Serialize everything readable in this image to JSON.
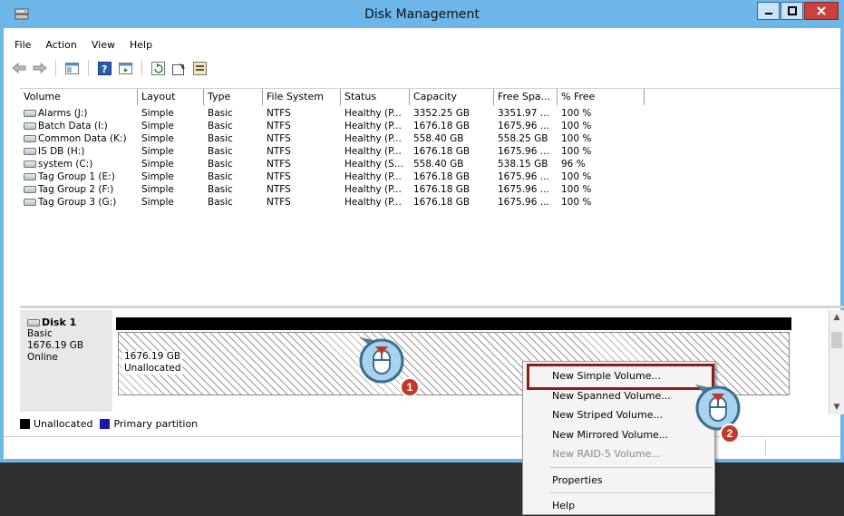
{
  "window": {
    "title": "Disk Management"
  },
  "menu": [
    "File",
    "Action",
    "View",
    "Help"
  ],
  "toolbar_icons": [
    "back-arrow-icon",
    "forward-arrow-icon",
    "console-icon",
    "help-icon",
    "view-icon",
    "refresh-icon",
    "properties-icon",
    "export-icon"
  ],
  "volume_list": {
    "columns": [
      "Volume",
      "Layout",
      "Type",
      "File System",
      "Status",
      "Capacity",
      "Free Spa...",
      "% Free"
    ],
    "rows": [
      [
        "Alarms (J:)",
        "Simple",
        "Basic",
        "NTFS",
        "Healthy (P...",
        "3352.25 GB",
        "3351.97 ...",
        "100 %"
      ],
      [
        "Batch Data (I:)",
        "Simple",
        "Basic",
        "NTFS",
        "Healthy (P...",
        "1676.18 GB",
        "1675.96 ...",
        "100 %"
      ],
      [
        "Common Data (K:)",
        "Simple",
        "Basic",
        "NTFS",
        "Healthy (P...",
        "558.40 GB",
        "558.25 GB",
        "100 %"
      ],
      [
        "IS DB (H:)",
        "Simple",
        "Basic",
        "NTFS",
        "Healthy (P...",
        "1676.18 GB",
        "1675.96 ...",
        "100 %"
      ],
      [
        "system (C:)",
        "Simple",
        "Basic",
        "NTFS",
        "Healthy (S...",
        "558.40 GB",
        "538.15 GB",
        "96 %"
      ],
      [
        "Tag Group 1 (E:)",
        "Simple",
        "Basic",
        "NTFS",
        "Healthy (P...",
        "1676.18 GB",
        "1675.96 ...",
        "100 %"
      ],
      [
        "Tag Group 2 (F:)",
        "Simple",
        "Basic",
        "NTFS",
        "Healthy (P...",
        "1676.18 GB",
        "1675.96 ...",
        "100 %"
      ],
      [
        "Tag Group 3 (G:)",
        "Simple",
        "Basic",
        "NTFS",
        "Healthy (P...",
        "1676.18 GB",
        "1675.96 ...",
        "100 %"
      ]
    ]
  },
  "disk": {
    "name": "Disk 1",
    "type": "Basic",
    "size": "1676.19 GB",
    "state": "Online",
    "partition_size": "1676.19 GB",
    "partition_label": "Unallocated"
  },
  "legend": [
    {
      "label": "Unallocated",
      "color": "#000000"
    },
    {
      "label": "Primary partition",
      "color": "#1a1aa6"
    }
  ],
  "context_menu": {
    "items": [
      {
        "label": "New Simple Volume...",
        "disabled": false
      },
      {
        "label": "New Spanned Volume...",
        "disabled": false
      },
      {
        "label": "New Striped Volume...",
        "disabled": false
      },
      {
        "label": "New Mirrored Volume...",
        "disabled": false
      },
      {
        "label": "New RAID-5 Volume...",
        "disabled": true
      }
    ],
    "items_after_sep": [
      {
        "label": "Properties"
      },
      {
        "label": "Help"
      }
    ]
  },
  "callouts": [
    "1",
    "2"
  ],
  "colors": {
    "titlebar": "#6cb6e8",
    "highlight": "#8b1c1c",
    "badge": "#c0392b"
  }
}
